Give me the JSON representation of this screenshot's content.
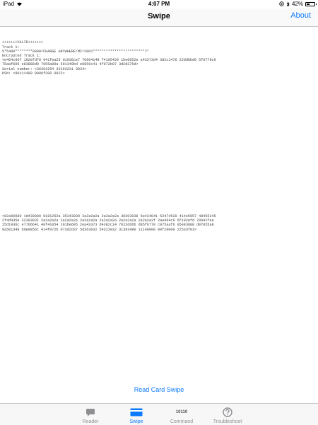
{
  "status_bar": {
    "device": "iPad",
    "time": "4:07 PM",
    "battery": "42%",
    "battery_level": 0.42
  },
  "nav": {
    "title": "Swipe",
    "about_label": "About"
  },
  "output": {
    "first_block": "+++++++VALID+++++++\nTrack 1:\n%*5480********0008^CHARGE ANYWHERE/MC^2001************************?*\nEncrypted Track 1:\n<e464c96f 102efd78 941fea25 d1936ce7 76664148 f4105420 1be6052e a43373d4 382c1476 22dd6bd0 5f6778c0\n75aaf605 e83888d0 7055a89a 501349bd e0856c41 4f072b07 3d2d375d>\nSerial number: <36303254 32393231 3934>\nKSN: <90111400 0000f200 0022>",
    "second_block": "<02a60080 1d430000 8181252a 35343830 2a2a2a2a 2a2a2a2a 30303038 5e434841 52474520 414e5957 48455245\n2f4d435e 32303031 2a2a2a2a 2a2a2a2a 2a2a2a2a 2a2a2a2a 2a2a2a2a 2a2a2a3f 2ae464c9 6f102efd 78941fea\n25d1936c e7766641 48f41054 201be605 2ea43373 d4382c14 7622dd6b d05f6778 c075aaf6 05e83888 d07055a8\n9a501349 bde0856c 414f072b 073d2d37 5d363032 54323932 31393490 11140000 00f20000 22533f03>"
  },
  "read_button_label": "Read Card Swipe",
  "tabs": [
    {
      "label": "Reader",
      "icon": "chat-bubble-icon"
    },
    {
      "label": "Swipe",
      "icon": "card-swipe-icon"
    },
    {
      "label": "Command",
      "icon": "binary-command-icon",
      "icon_text": "10110"
    },
    {
      "label": "Troubleshoot",
      "icon": "question-circle-icon"
    }
  ],
  "colors": {
    "accent": "#0a7aff",
    "inactive": "#929292"
  }
}
